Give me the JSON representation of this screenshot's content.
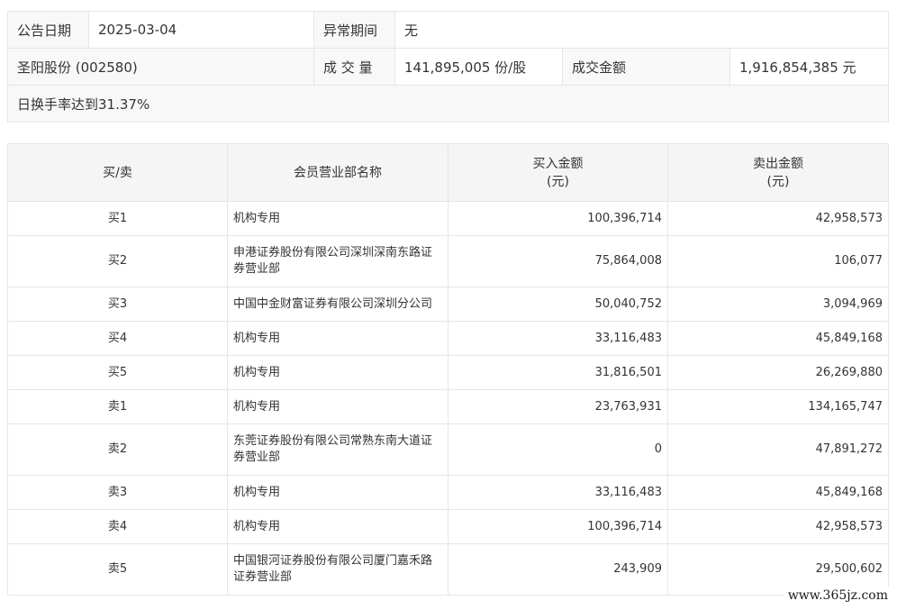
{
  "info": {
    "announce_date_label": "公告日期",
    "announce_date_value": "2025-03-04",
    "abnormal_period_label": "异常期间",
    "abnormal_period_value": "无",
    "stock_name": "圣阳股份 (002580)",
    "volume_label": "成 交 量",
    "volume_value": "141,895,005 份/股",
    "amount_label": "成交金额",
    "amount_value": "1,916,854,385 元",
    "reason": "日换手率达到31.37%"
  },
  "trade": {
    "headers": {
      "side": "买/卖",
      "branch": "会员营业部名称",
      "buy": "买入金额",
      "buy_unit": "(元)",
      "sell": "卖出金额",
      "sell_unit": "(元)"
    },
    "rows": [
      {
        "side": "买1",
        "branch": "机构专用",
        "buy": "100,396,714",
        "sell": "42,958,573"
      },
      {
        "side": "买2",
        "branch": "申港证券股份有限公司深圳深南东路证券营业部",
        "buy": "75,864,008",
        "sell": "106,077"
      },
      {
        "side": "买3",
        "branch": "中国中金财富证券有限公司深圳分公司",
        "buy": "50,040,752",
        "sell": "3,094,969"
      },
      {
        "side": "买4",
        "branch": "机构专用",
        "buy": "33,116,483",
        "sell": "45,849,168"
      },
      {
        "side": "买5",
        "branch": "机构专用",
        "buy": "31,816,501",
        "sell": "26,269,880"
      },
      {
        "side": "卖1",
        "branch": "机构专用",
        "buy": "23,763,931",
        "sell": "134,165,747"
      },
      {
        "side": "卖2",
        "branch": "东莞证券股份有限公司常熟东南大道证券营业部",
        "buy": "0",
        "sell": "47,891,272"
      },
      {
        "side": "卖3",
        "branch": "机构专用",
        "buy": "33,116,483",
        "sell": "45,849,168"
      },
      {
        "side": "卖4",
        "branch": "机构专用",
        "buy": "100,396,714",
        "sell": "42,958,573"
      },
      {
        "side": "卖5",
        "branch": "中国银河证券股份有限公司厦门嘉禾路证券营业部",
        "buy": "243,909",
        "sell": "29,500,602"
      }
    ]
  },
  "watermark": "www.365jz.com"
}
